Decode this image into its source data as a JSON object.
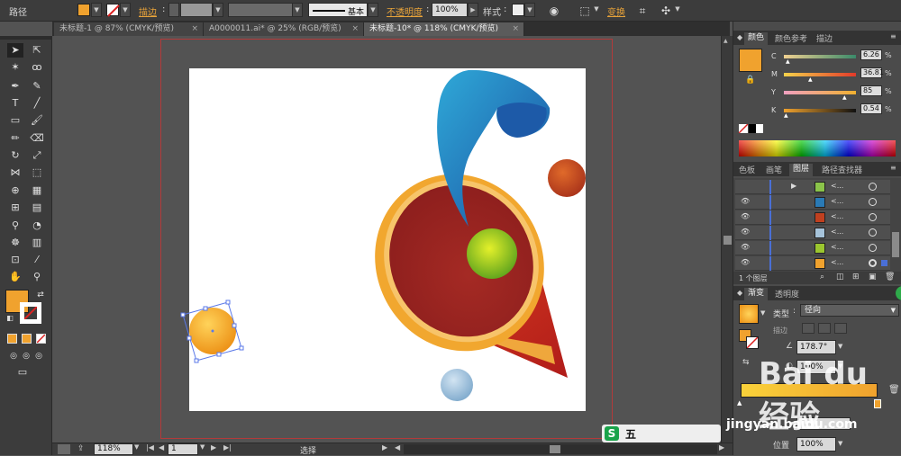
{
  "control_bar": {
    "object_type": "路径",
    "stroke_label": "描边",
    "stroke_style": "基本",
    "opacity_label": "不透明度",
    "opacity_value": "100%",
    "style_label": "样式",
    "transform_label": "变换"
  },
  "doc_tabs": [
    {
      "label": "未标题-1 @ 87% (CMYK/预览)"
    },
    {
      "label": "A0000011.ai* @ 25% (RGB/预览)"
    },
    {
      "label": "未标题-10* @ 118% (CMYK/预览)"
    }
  ],
  "status_bar": {
    "zoom": "118%",
    "page": "1",
    "tool_name": "选择"
  },
  "color_panel": {
    "tabs": [
      "颜色",
      "颜色参考",
      "描边"
    ],
    "channels": [
      {
        "name": "C",
        "value": "6.26",
        "fraction": 0.06
      },
      {
        "name": "M",
        "value": "36.81",
        "fraction": 0.37
      },
      {
        "name": "Y",
        "value": "85",
        "fraction": 0.85
      },
      {
        "name": "K",
        "value": "0.54",
        "fraction": 0.01
      }
    ],
    "fill_color": "#f0a22e"
  },
  "layers_panel": {
    "tabs": [
      "色板",
      "画笔",
      "图层",
      "路径查找器"
    ],
    "items": [
      {
        "name": "<...",
        "thumb": "#8bc34a",
        "visible": false
      },
      {
        "name": "<...",
        "thumb": "#2a7ab5",
        "visible": true
      },
      {
        "name": "<...",
        "thumb": "#c0401f",
        "visible": true
      },
      {
        "name": "<...",
        "thumb": "#a6c3da",
        "visible": true
      },
      {
        "name": "<...",
        "thumb": "#9bc62f",
        "visible": true
      },
      {
        "name": "<...",
        "thumb": "#f0a22e",
        "visible": true
      }
    ],
    "layer_count": "1 个图层"
  },
  "gradient_panel": {
    "tabs": [
      "渐变",
      "透明度"
    ],
    "type_label": "类型",
    "type_value": "径向",
    "stroke_label": "描边",
    "angle_value": "178.7°",
    "aspect_value": "100%",
    "position_label": "位置",
    "position_value": "100%"
  },
  "watermark": {
    "brand": "Bai du 经验",
    "url": "jingyan.baidu.com",
    "partner": "五"
  },
  "colors": {
    "ui_dark": "#3c3c3c",
    "ui_mid": "#535353",
    "accent_orange": "#e8a33a",
    "artboard_border": "#b33a3a"
  }
}
